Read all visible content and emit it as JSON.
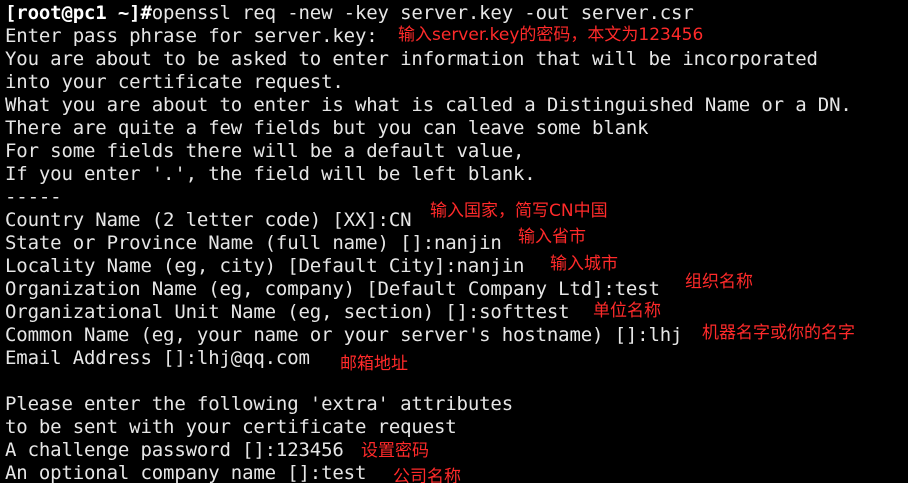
{
  "terminal": {
    "lines": [
      "[root@pc1 ~]#openssl req -new -key server.key -out server.csr",
      "Enter pass phrase for server.key:",
      "You are about to be asked to enter information that will be incorporated",
      "into your certificate request.",
      "What you are about to enter is what is called a Distinguished Name or a DN.",
      "There are quite a few fields but you can leave some blank",
      "For some fields there will be a default value,",
      "If you enter '.', the field will be left blank.",
      "-----",
      "Country Name (2 letter code) [XX]:CN",
      "State or Province Name (full name) []:nanjin",
      "Locality Name (eg, city) [Default City]:nanjin",
      "Organization Name (eg, company) [Default Company Ltd]:test",
      "Organizational Unit Name (eg, section) []:softtest",
      "Common Name (eg, your name or your server's hostname) []:lhj",
      "Email Address []:lhj@qq.com",
      "",
      "Please enter the following 'extra' attributes",
      "to be sent with your certificate request",
      "A challenge password []:123456",
      "An optional company name []:test"
    ],
    "prompt": "[root@pc1 ~]#",
    "command": "openssl req -new -key server.key -out server.csr"
  },
  "annotations": {
    "pass_phrase": "输入server.key的密码，本文为123456",
    "country": "输入国家，简写CN中国",
    "state": "输入省市",
    "locality": "输入城市",
    "organization": "组织名称",
    "org_unit": "单位名称",
    "common_name": "机器名字或你的名字",
    "email": "邮箱地址",
    "challenge_password": "设置密码",
    "company_name": "公司名称"
  },
  "colors": {
    "background": "#000000",
    "text": "#e6e6e6",
    "annotation": "#ff2a2a"
  }
}
